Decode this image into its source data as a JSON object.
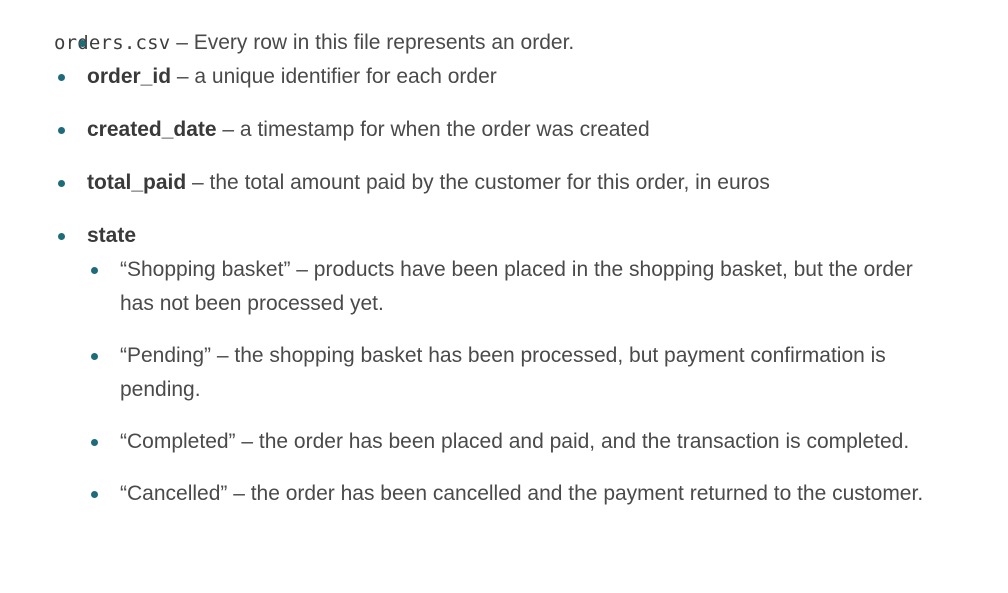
{
  "document": {
    "file": {
      "name": "orders.csv",
      "description": " – Every row in this file represents an order."
    },
    "fields": [
      {
        "name": "order_id",
        "description": " – a unique identifier for each order"
      },
      {
        "name": "created_date",
        "description": " – a timestamp for when the order was created"
      },
      {
        "name": "total_paid",
        "description": " – the total amount paid by the customer for this order, in euros"
      }
    ],
    "state_field": {
      "name": "state",
      "values": [
        "“Shopping basket” – products have been placed in the shopping basket, but the order has not been processed yet.",
        "“Pending” – the shopping basket has been processed, but payment confirmation is pending.",
        "“Completed” – the order has been placed and paid, and the transaction is completed.",
        "“Cancelled” – the order has been cancelled and the payment returned to the customer."
      ]
    }
  },
  "colors": {
    "bullet": "#1e6b7a",
    "text": "#4a4a4a"
  }
}
